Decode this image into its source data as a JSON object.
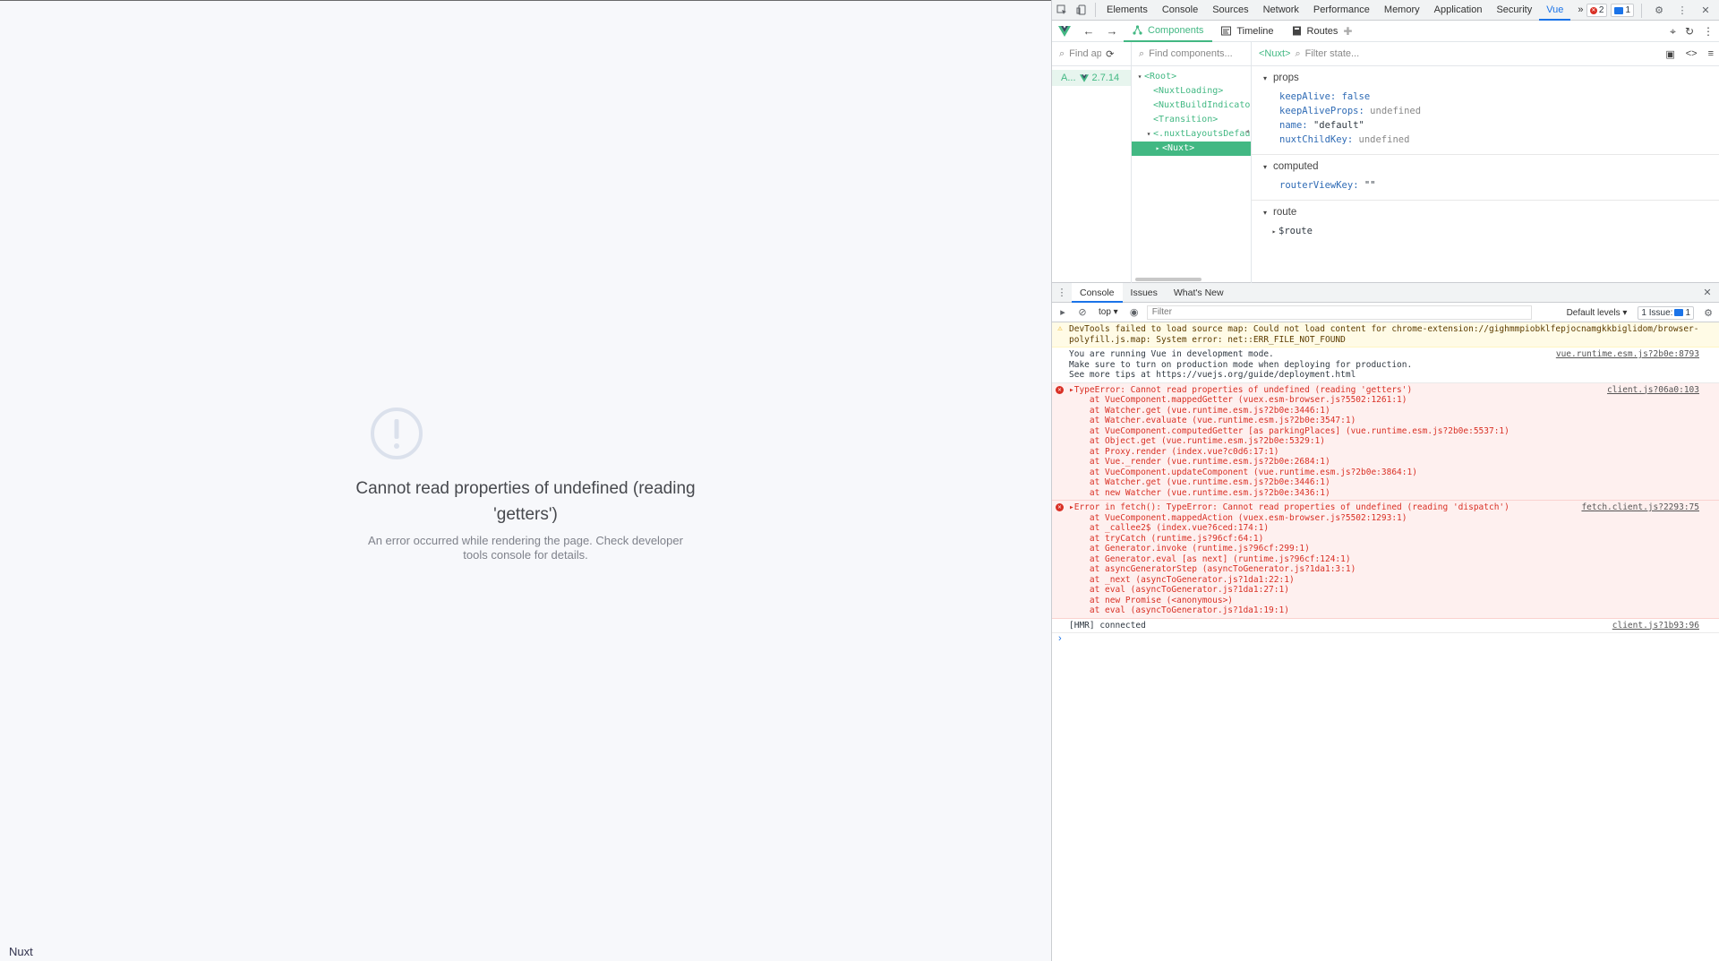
{
  "page": {
    "error_title": "Cannot read properties of undefined (reading 'getters')",
    "error_description": "An error occurred while rendering the page. Check developer tools console for details.",
    "footer_label": "Nuxt"
  },
  "devtools": {
    "tabs": [
      "Elements",
      "Console",
      "Sources",
      "Network",
      "Performance",
      "Memory",
      "Application",
      "Security",
      "Vue"
    ],
    "active_tab": "Vue",
    "more": "»",
    "error_count": "2",
    "message_count": "1"
  },
  "vue": {
    "tabs": [
      "Components",
      "Timeline",
      "Routes"
    ],
    "app_filter_placeholder": "Find apps...",
    "app_name": "A...",
    "vue_version": "2.7.14",
    "components_placeholder": "Find components...",
    "selected_component": "<Nuxt>",
    "state_placeholder": "Filter state...",
    "tree": [
      {
        "label": "<Root>",
        "indent": 0,
        "arrow": "▾"
      },
      {
        "label": "<NuxtLoading>",
        "indent": 1,
        "arrow": ""
      },
      {
        "label": "<NuxtBuildIndicator>",
        "indent": 1,
        "arrow": ""
      },
      {
        "label": "<Transition>",
        "indent": 1,
        "arrow": ""
      },
      {
        "label": "<.nuxtLayoutsDefault>",
        "indent": 1,
        "arrow": "▾"
      },
      {
        "label": "<Nuxt>",
        "indent": 2,
        "arrow": "▸",
        "selected": true
      }
    ],
    "props_title": "props",
    "props": [
      {
        "key": "keepAlive",
        "value": "false",
        "type": "false"
      },
      {
        "key": "keepAliveProps",
        "value": "undefined",
        "type": "undef"
      },
      {
        "key": "name",
        "value": "\"default\"",
        "type": "str"
      },
      {
        "key": "nuxtChildKey",
        "value": "undefined",
        "type": "undef"
      }
    ],
    "computed_title": "computed",
    "computed": [
      {
        "key": "routerViewKey",
        "value": "\"\""
      }
    ],
    "route_title": "route",
    "route_item": "$route"
  },
  "drawer": {
    "tabs": [
      "Console",
      "Issues",
      "What's New"
    ],
    "context": "top",
    "filter_placeholder": "Filter",
    "levels": "Default levels",
    "issues": "1 Issue:",
    "issues_count": "1"
  },
  "console": [
    {
      "level": "warn",
      "text": "DevTools failed to load source map: Could not load content for chrome-extension://gighmmpiobklfepjocnamgkkbiglidom/browser-polyfill.js.map: System error: net::ERR_FILE_NOT_FOUND",
      "source": ""
    },
    {
      "level": "info",
      "text": "You are running Vue in development mode.\nMake sure to turn on production mode when deploying for production.\nSee more tips at https://vuejs.org/guide/deployment.html",
      "source": "vue.runtime.esm.js?2b0e:8793"
    },
    {
      "level": "err",
      "text": "▸TypeError: Cannot read properties of undefined (reading 'getters')\n    at VueComponent.mappedGetter (vuex.esm-browser.js?5502:1261:1)\n    at Watcher.get (vue.runtime.esm.js?2b0e:3446:1)\n    at Watcher.evaluate (vue.runtime.esm.js?2b0e:3547:1)\n    at VueComponent.computedGetter [as parkingPlaces] (vue.runtime.esm.js?2b0e:5537:1)\n    at Object.get (vue.runtime.esm.js?2b0e:5329:1)\n    at Proxy.render (index.vue?c0d6:17:1)\n    at Vue._render (vue.runtime.esm.js?2b0e:2684:1)\n    at VueComponent.updateComponent (vue.runtime.esm.js?2b0e:3864:1)\n    at Watcher.get (vue.runtime.esm.js?2b0e:3446:1)\n    at new Watcher (vue.runtime.esm.js?2b0e:3436:1)",
      "source": "client.js?06a0:103"
    },
    {
      "level": "err",
      "text": "▸Error in fetch(): TypeError: Cannot read properties of undefined (reading 'dispatch')\n    at VueComponent.mappedAction (vuex.esm-browser.js?5502:1293:1)\n    at _callee2$ (index.vue?6ced:174:1)\n    at tryCatch (runtime.js?96cf:64:1)\n    at Generator.invoke (runtime.js?96cf:299:1)\n    at Generator.eval [as next] (runtime.js?96cf:124:1)\n    at asyncGeneratorStep (asyncToGenerator.js?1da1:3:1)\n    at _next (asyncToGenerator.js?1da1:22:1)\n    at eval (asyncToGenerator.js?1da1:27:1)\n    at new Promise (<anonymous>)\n    at eval (asyncToGenerator.js?1da1:19:1)",
      "source": "fetch.client.js?2293:75"
    },
    {
      "level": "info",
      "text": "[HMR] connected",
      "source": "client.js?1b93:96"
    }
  ]
}
